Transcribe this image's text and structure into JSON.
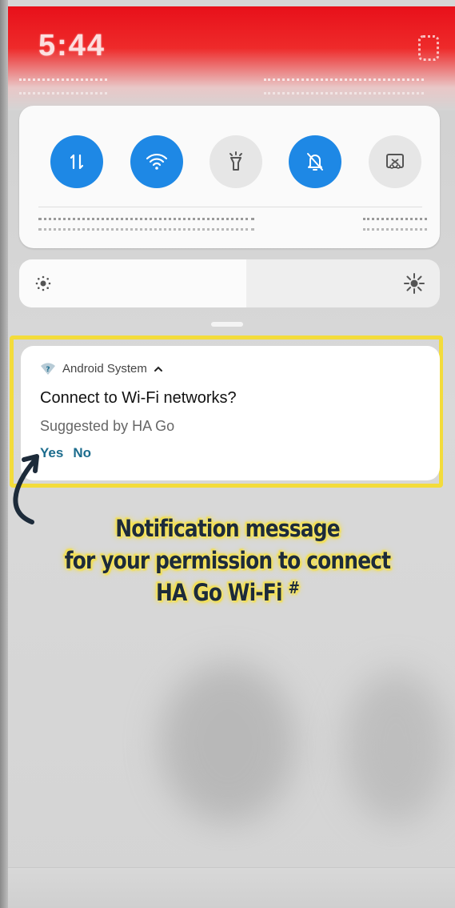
{
  "status_bar": {
    "time": "5:44"
  },
  "quick_settings": {
    "tiles": [
      {
        "icon": "mobile-data-icon",
        "state": "on"
      },
      {
        "icon": "wifi-icon",
        "state": "on"
      },
      {
        "icon": "flashlight-icon",
        "state": "off"
      },
      {
        "icon": "mute-icon",
        "state": "on"
      },
      {
        "icon": "screen-capture-icon",
        "state": "off"
      }
    ],
    "brightness_level": 0.54,
    "accent_color": "#1e88e5"
  },
  "notification": {
    "app_name": "Android System",
    "title": "Connect to Wi-Fi networks?",
    "subtitle": "Suggested by HA Go",
    "actions": {
      "yes": "Yes",
      "no": "No"
    },
    "action_color": "#1c6c8d"
  },
  "annotation": {
    "line1": "Notification message",
    "line2": "for your permission to connect",
    "line3": "HA Go Wi-Fi",
    "mark": "#",
    "highlight_color": "#f3dc3b"
  }
}
